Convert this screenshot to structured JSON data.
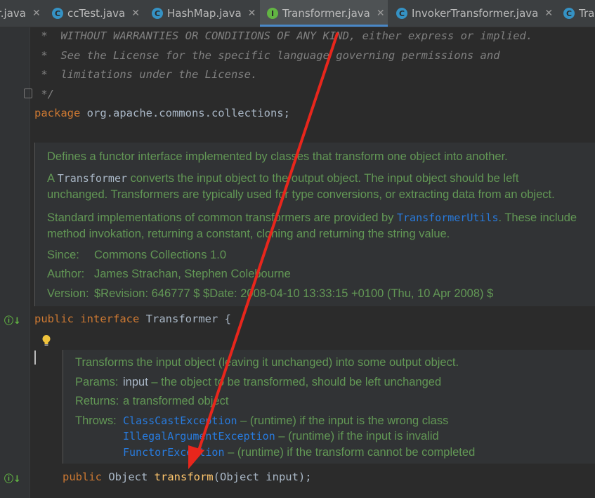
{
  "tabs": [
    {
      "label": "r.java",
      "icon": "none"
    },
    {
      "label": "ccTest.java",
      "icon": "C"
    },
    {
      "label": "HashMap.java",
      "icon": "C"
    },
    {
      "label": "Transformer.java",
      "icon": "I"
    },
    {
      "label": "InvokerTransformer.java",
      "icon": "C"
    },
    {
      "label": "Tra",
      "icon": "C"
    }
  ],
  "license_lines": [
    " *  WITHOUT WARRANTIES OR CONDITIONS OF ANY KIND, either express or implied.",
    " *  See the License for the specific language governing permissions and",
    " *  limitations under the License.",
    " */"
  ],
  "package_kw": "package",
  "package_name": " org.apache.commons.collections;",
  "class_doc": {
    "line1": "Defines a functor interface implemented by classes that transform one object into another.",
    "line2a": "A ",
    "line2_code": "Transformer",
    "line2b": " converts the input object to the output object. The input object should be left",
    "line3": "unchanged. Transformers are typically used for type conversions, or extracting data from an object.",
    "line4a": "Standard implementations of common transformers are provided by ",
    "line4_link": "TransformerUtils",
    "line4b": ". These include",
    "line5": "method invokation, returning a constant, cloning and returning the string value.",
    "since_label": "Since:",
    "since_value": "Commons Collections 1.0",
    "author_label": "Author:",
    "author_value": "James Strachan, Stephen Colebourne",
    "version_label": "Version:",
    "version_value": "$Revision: 646777 $ $Date: 2008-04-10 13:33:15 +0100 (Thu, 10 Apr 2008) $"
  },
  "interface_decl": {
    "kw1": "public",
    "kw2": " interface",
    "name": " Transformer {"
  },
  "method_doc": {
    "desc": "Transforms the input object (leaving it unchanged) into some output object.",
    "params_label": "Params:",
    "params_name": "input",
    "params_desc": " – the object to be transformed, should be left unchanged",
    "returns_label": "Returns:",
    "returns_value": "a transformed object",
    "throws_label": "Throws:",
    "throws": [
      {
        "ex": "ClassCastException",
        "desc": " – (runtime) if the input is the wrong class"
      },
      {
        "ex": "IllegalArgumentException",
        "desc": " – (runtime) if the input is invalid"
      },
      {
        "ex": "FunctorException",
        "desc": " – (runtime) if the transform cannot be completed"
      }
    ]
  },
  "method_decl": {
    "kw": "public",
    "type": " Object ",
    "name": "transform",
    "params": "(Object input);"
  },
  "colors": {
    "arrow": "#e8261c",
    "keyword": "#cc7832",
    "doc_text": "#629755",
    "link": "#287bde"
  }
}
